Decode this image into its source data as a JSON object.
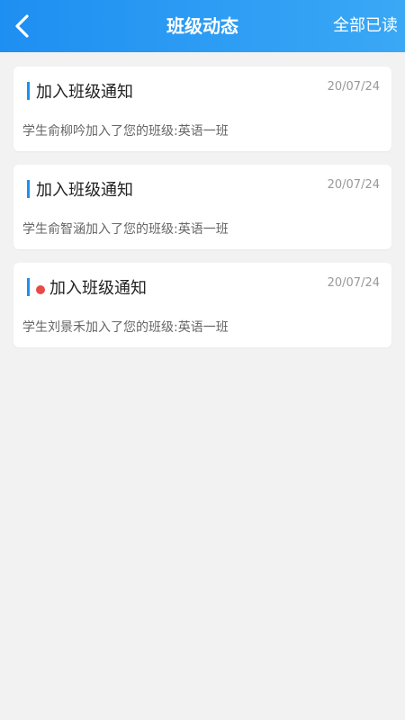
{
  "header": {
    "title": "班级动态",
    "read_all_label": "全部已读"
  },
  "notices": [
    {
      "title": "加入班级通知",
      "date": "20/07/24",
      "message": "学生俞柳吟加入了您的班级:英语一班",
      "unread": false
    },
    {
      "title": "加入班级通知",
      "date": "20/07/24",
      "message": "学生俞智涵加入了您的班级:英语一班",
      "unread": false
    },
    {
      "title": "加入班级通知",
      "date": "20/07/24",
      "message": "学生刘景禾加入了您的班级:英语一班",
      "unread": true
    }
  ],
  "colors": {
    "header_start": "#1e8ff2",
    "header_end": "#3aa8f5",
    "accent": "#1e8ff2",
    "unread_dot": "#e84a4a",
    "background": "#f2f2f2"
  },
  "icons": {
    "back": "chevron-left-icon"
  }
}
